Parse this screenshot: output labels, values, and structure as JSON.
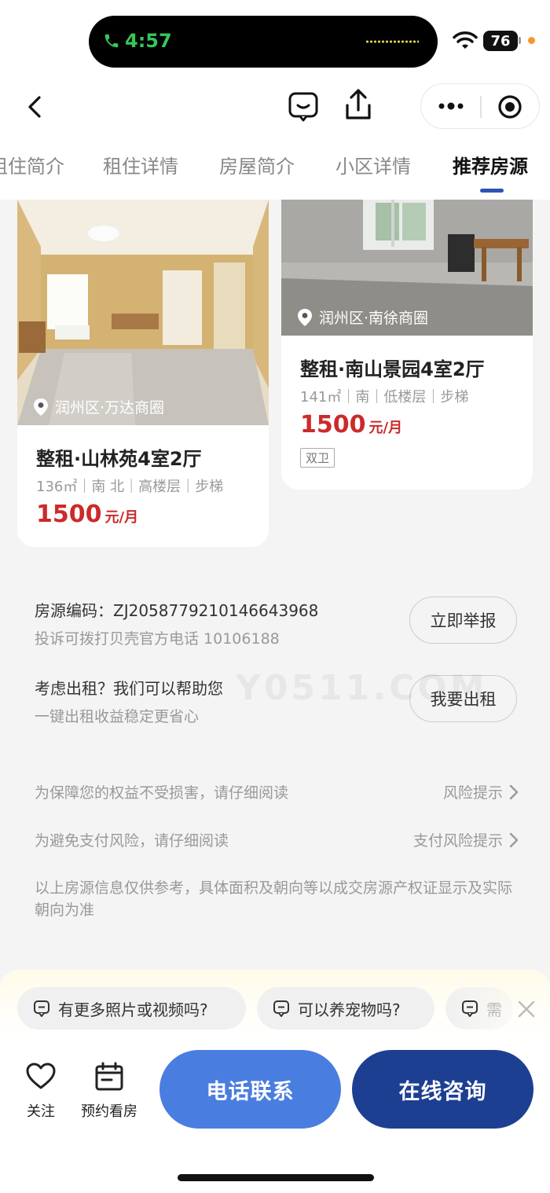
{
  "status": {
    "time": "4:57",
    "battery": "76"
  },
  "tabs": [
    {
      "label": "租住简介"
    },
    {
      "label": "租住详情"
    },
    {
      "label": "房屋简介"
    },
    {
      "label": "小区详情"
    },
    {
      "label": "推荐房源",
      "active": true
    }
  ],
  "cards": [
    {
      "location": "润州区·万达商圈",
      "title": "整租·山林苑4室2厅",
      "meta": "136㎡｜南 北｜高楼层｜步梯",
      "price": "1500",
      "unit": "元/月",
      "tags": []
    },
    {
      "location": "润州区·南徐商圈",
      "title": "整租·南山景园4室2厅",
      "meta": "141㎡｜南｜低楼层｜步梯",
      "price": "1500",
      "unit": "元/月",
      "tags": [
        "双卫"
      ]
    }
  ],
  "listing": {
    "code_label": "房源编码：ZJ2058779210146643968",
    "complaint": "投诉可拨打贝壳官方电话 10106188",
    "report_button": "立即举报",
    "rent_prompt": "考虑出租？我们可以帮助您",
    "rent_sub": "一键出租收益稳定更省心",
    "rent_button": "我要出租",
    "watermark": "Y0511.COM"
  },
  "risk": [
    {
      "text": "为保障您的权益不受损害，请仔细阅读",
      "link": "风险提示"
    },
    {
      "text": "为避免支付风险，请仔细阅读",
      "link": "支付风险提示"
    }
  ],
  "disclaimer": "以上房源信息仅供参考，具体面积及朝向等以成交房源产权证显示及实际朝向为准",
  "quick_questions": [
    "有更多照片或视频吗?",
    "可以养宠物吗?",
    "需"
  ],
  "actions": {
    "follow": "关注",
    "schedule": "预约看房",
    "call": "电话联系",
    "chat": "在线咨询"
  },
  "colors": {
    "accent_blue": "#2d53b6",
    "call_button": "#4a7de0",
    "chat_button": "#1d3f92",
    "price_red": "#cc2a2a"
  }
}
